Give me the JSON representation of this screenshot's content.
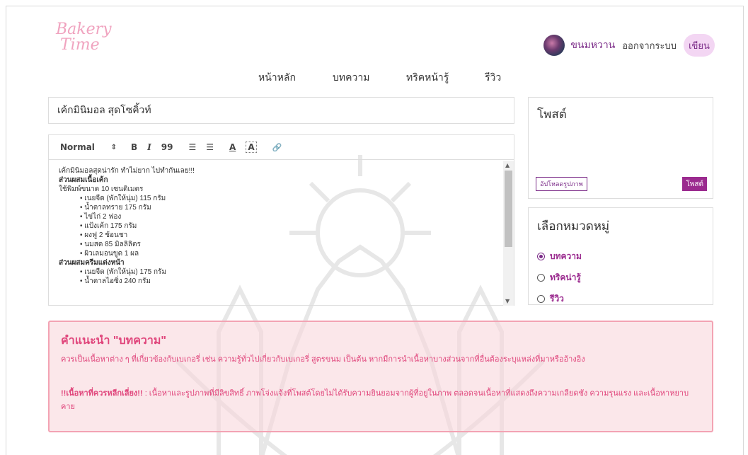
{
  "logo": {
    "line1": "Bakery",
    "line2": "Time"
  },
  "nav": {
    "items": [
      {
        "label": "หน้าหลัก"
      },
      {
        "label": "บทความ"
      },
      {
        "label": "ทริคหน้ารู้"
      },
      {
        "label": "รีวิว"
      }
    ]
  },
  "user": {
    "name": "ขนมหวาน",
    "logout_label": "ออกจากระบบ",
    "write_label": "เขียน"
  },
  "editor": {
    "title_value": "เค้กมินิมอล สุดโซคิ้วท์",
    "toolbar": {
      "format_select": "Normal",
      "bold": "B",
      "italic": "I",
      "quote": "99",
      "list_ordered": "☰",
      "list_bullet": "☰",
      "font_color": "A",
      "background_color": "A",
      "link": "🔗"
    },
    "content": {
      "intro": "เค้กมินิมอลสุดน่ารัก ทำไม่ยาก ไปทำกันเลย!!!",
      "section1_title": "ส่วนผสมเนื้อเค้ก",
      "section1_sub": "ใช้พิมพ์ขนาด 10 เซนติเมตร",
      "section1_items": [
        "เนยจืด (พักให้นุ่ม) 115 กรัม",
        "น้ำตาลทราย 175 กรัม",
        "ไข่ไก่ 2 ฟอง",
        "แป้งเค้ก 175 กรัม",
        "ผงฟู 2 ช้อนชา",
        "นมสด 85 มิลลิลิตร",
        "ผิวเลมอนขูด 1 ผล"
      ],
      "section2_title": "ส่วนผสมครีมแต่งหน้า",
      "section2_items": [
        "เนยจืด (พักให้นุ่ม) 175 กรัม",
        "น้ำตาลไอซิ่ง 240 กรัม"
      ]
    }
  },
  "post_panel": {
    "heading": "โพสต์",
    "upload_label": "อัปโหลดรูปภาพ",
    "post_label": "โพสต์"
  },
  "category_panel": {
    "heading": "เลือกหมวดหมู่",
    "options": [
      {
        "label": "บทความ",
        "selected": true
      },
      {
        "label": "ทริคน่ารู้",
        "selected": false
      },
      {
        "label": "รีวิว",
        "selected": false
      }
    ]
  },
  "guide": {
    "title": "คำแนะนำ \"บทความ\"",
    "paragraph1": "ควรเป็นเนื้อหาต่าง ๆ ที่เกี่ยวข้องกับเบเกอรี่ เช่น ความรู้ทั่วไปเกี่ยวกับเบเกอรี่ สูตรขนม เป็นต้น หากมีการนำเนื้อหาบางส่วนจากที่อื่นต้องระบุแหล่งที่มาหรืออ้างอิง",
    "paragraph2_bold": "!!เนื้อหาที่ควรหลีกเลี่ยง!!",
    "paragraph2_rest": " : เนื้อหาและรูปภาพที่มีลิขสิทธิ์ ภาพโจ่งแจ้งที่โพสต์โดยไม่ได้รับความยินยอมจากผู้ที่อยู่ในภาพ ตลอดจนเนื้อหาที่แสดงถึงความเกลียดชัง ความรุนแรง และเนื้อหาหยาบคาย"
  },
  "colors": {
    "brand_purple": "#7b2b88",
    "accent_pink": "#f0a3bf",
    "guide_text": "#e0457b",
    "guide_bg": "#f8d7dc"
  }
}
